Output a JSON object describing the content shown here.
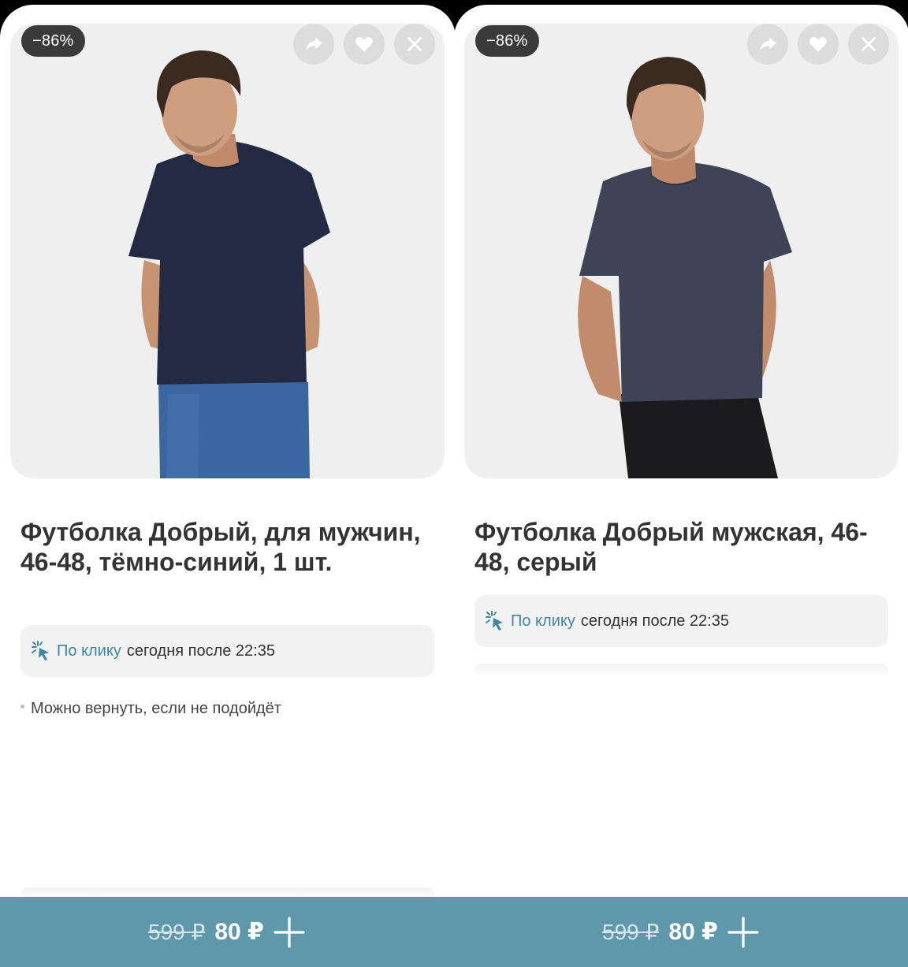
{
  "colors": {
    "accent": "#5f97ab",
    "link": "#3e86a2",
    "badge": "#3a3a3a",
    "photo_bg": "#efefef"
  },
  "products": [
    {
      "discount": "−86%",
      "title": "Футболка Добрый, для мужчин, 46-48, тёмно-синий, 1 шт.",
      "delivery_link": "По клику",
      "delivery_text": "сегодня после 22:35",
      "returns": "Можно вернуть, если не подойдёт",
      "old_price": "599 ₽",
      "new_price": "80 ₽",
      "icons": [
        "share-icon",
        "heart-icon",
        "close-icon",
        "sparkle-icon",
        "plus-icon"
      ]
    },
    {
      "discount": "−86%",
      "title": "Футболка Добрый мужская, 46-48, серый",
      "delivery_link": "По клику",
      "delivery_text": "сегодня после 22:35",
      "old_price": "599 ₽",
      "new_price": "80 ₽",
      "icons": [
        "share-icon",
        "heart-icon",
        "close-icon",
        "sparkle-icon",
        "plus-icon"
      ]
    }
  ]
}
